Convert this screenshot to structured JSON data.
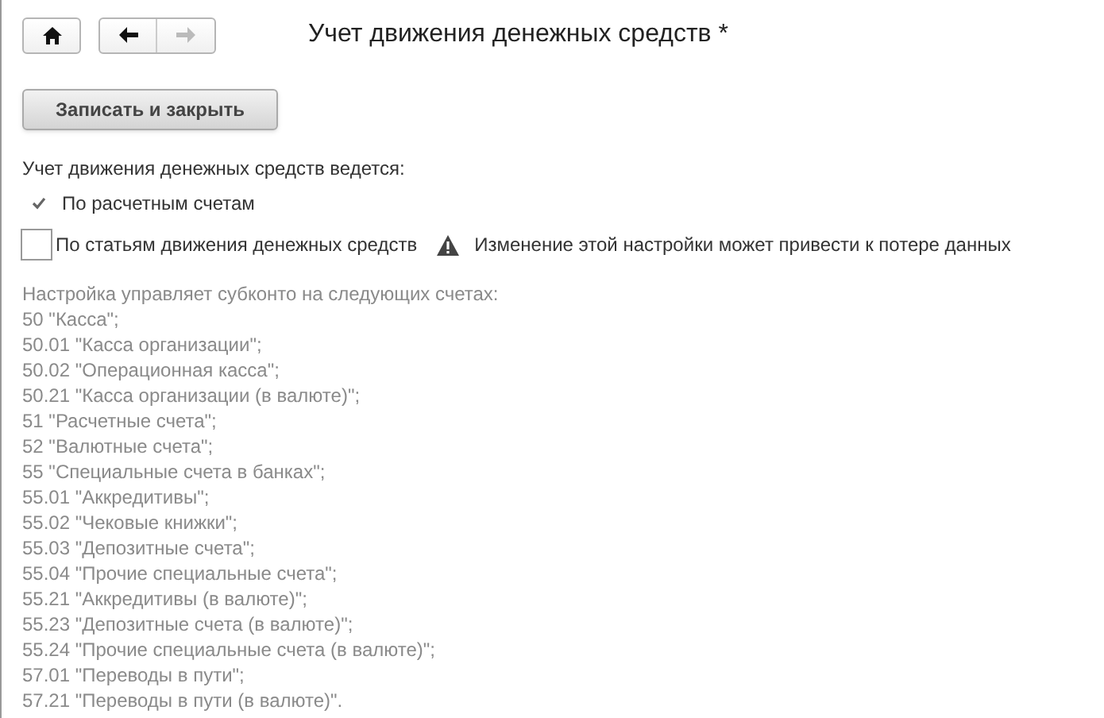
{
  "toolbar": {
    "home": {
      "disabled": false
    },
    "back": {
      "disabled": false
    },
    "forward": {
      "disabled": true
    }
  },
  "title": "Учет движения денежных средств *",
  "save_button": "Записать и закрыть",
  "section_label": "Учет движения денежных средств ведется:",
  "options": [
    {
      "label": "По расчетным счетам",
      "checked": true
    },
    {
      "label": "По статьям движения денежных средств",
      "checked": false,
      "warning": "Изменение этой настройки может привести к потере данных"
    }
  ],
  "info": {
    "heading": "Настройка управляет субконто на следующих счетах:",
    "lines": [
      "50 \"Касса\";",
      "50.01 \"Касса организации\";",
      "50.02 \"Операционная касса\";",
      "50.21 \"Касса организации (в валюте)\";",
      "51 \"Расчетные счета\";",
      "52 \"Валютные счета\";",
      "55 \"Специальные счета в банках\";",
      "55.01 \"Аккредитивы\";",
      "55.02 \"Чековые книжки\";",
      "55.03 \"Депозитные счета\";",
      "55.04 \"Прочие специальные счета\";",
      "55.21 \"Аккредитивы (в валюте)\";",
      "55.23 \"Депозитные счета (в валюте)\";",
      "55.24 \"Прочие специальные счета (в валюте)\";",
      "57.01 \"Переводы в пути\";",
      "57.21 \"Переводы в пути (в валюте)\"."
    ]
  }
}
